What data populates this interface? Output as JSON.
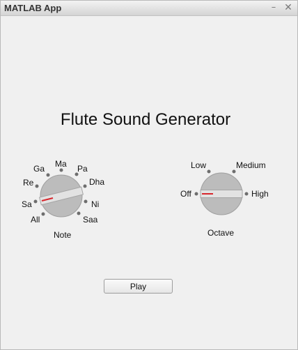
{
  "window": {
    "title": "MATLAB App",
    "minimize_glyph": "–",
    "close_glyph": "✕"
  },
  "app": {
    "heading": "Flute Sound Generator",
    "note_knob": {
      "label": "Note",
      "items": [
        "All",
        "Sa",
        "Re",
        "Ga",
        "Ma",
        "Pa",
        "Dha",
        "Ni",
        "Saa"
      ],
      "selected": "Sa"
    },
    "octave_knob": {
      "label": "Octave",
      "items": [
        "Off",
        "Low",
        "Medium",
        "High"
      ],
      "selected": "Off"
    },
    "play_label": "Play"
  },
  "colors": {
    "knob_body": "#bcbcbc",
    "knob_bar": "#e2e2e2",
    "pointer": "#d7262c",
    "tick": "#6e6e6e"
  }
}
